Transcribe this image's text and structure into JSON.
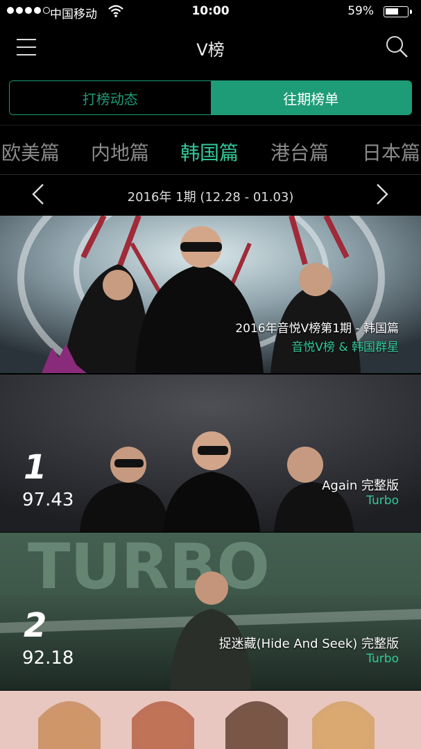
{
  "status_bar": {
    "carrier": "中国移动",
    "time": "10:00",
    "battery": "59%"
  },
  "navbar": {
    "title": "V榜",
    "menu_icon": "menu-icon",
    "search_icon": "search-icon"
  },
  "segment": {
    "tabs": [
      {
        "label": "打榜动态",
        "active": false
      },
      {
        "label": "往期榜单",
        "active": true
      }
    ]
  },
  "region_tabs": {
    "items": [
      {
        "label": "欧美篇",
        "active": false
      },
      {
        "label": "内地篇",
        "active": false
      },
      {
        "label": "韩国篇",
        "active": true
      },
      {
        "label": "港台篇",
        "active": false
      },
      {
        "label": "日本篇",
        "active": false
      }
    ]
  },
  "period": {
    "text": "2016年 1期 (12.28 - 01.03)",
    "prev_icon": "chevron-left-icon",
    "next_icon": "chevron-right-icon"
  },
  "banner": {
    "title": "2016年音悦V榜第1期 - 韩国篇",
    "subtitle": "音悦V榜 & 韩国群星"
  },
  "chart": [
    {
      "rank": "1",
      "score": "97.43",
      "title": "Again 完整版",
      "artist": "Turbo"
    },
    {
      "rank": "2",
      "score": "92.18",
      "title": "捉迷藏(Hide And Seek) 完整版",
      "artist": "Turbo"
    }
  ],
  "colors": {
    "accent": "#1e9c77",
    "accent_text": "#33c99a",
    "background": "#000000"
  }
}
